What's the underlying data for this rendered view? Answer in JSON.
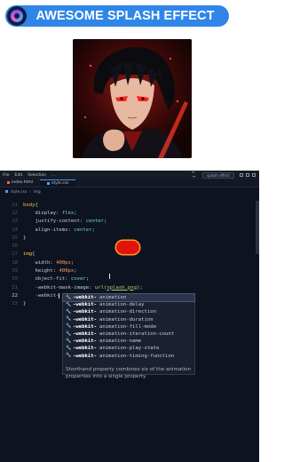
{
  "header": {
    "title": "AWESOME SPLASH EFFECT",
    "logo": "purple-ring-logo"
  },
  "hero": {
    "description_icon": "anime-character-artwork"
  },
  "editor": {
    "menu": [
      "File",
      "Edit",
      "Selection",
      "..."
    ],
    "nav_arrows": "← →",
    "search_placeholder": "splash effect",
    "tabs": [
      {
        "label": "index.html",
        "type": "html"
      },
      {
        "label": "style.css",
        "type": "css",
        "active": true
      }
    ],
    "breadcrumb": [
      "style.css",
      "img"
    ],
    "lines": [
      {
        "n": "11"
      },
      {
        "n": "12"
      },
      {
        "n": "13"
      },
      {
        "n": "14"
      },
      {
        "n": "15"
      },
      {
        "n": "16"
      },
      {
        "n": "17"
      },
      {
        "n": "18"
      },
      {
        "n": "19"
      },
      {
        "n": "20"
      },
      {
        "n": "21"
      },
      {
        "n": "22"
      },
      {
        "n": "23"
      }
    ],
    "code": {
      "body_sel": "body",
      "display": "display",
      "display_val": "flex",
      "justify": "justify-content",
      "justify_val": "center",
      "align": "align-items",
      "align_val": "center",
      "img_sel": "img",
      "width": "width",
      "width_val": "400px",
      "height": "height",
      "height_val": "400px",
      "fit": "object-fit",
      "fit_val": "cover",
      "mask": "-webkit-mask-image",
      "mask_fn": "url",
      "mask_arg": "splash.png",
      "typing": "-webkit-"
    },
    "suggestions": [
      {
        "bold": "-webkit-",
        "rest": "animation"
      },
      {
        "bold": "-webkit-",
        "rest": "animation-delay"
      },
      {
        "bold": "-webkit-",
        "rest": "animation-direction"
      },
      {
        "bold": "-webkit-",
        "rest": "animation-duration"
      },
      {
        "bold": "-webkit-",
        "rest": "animation-fill-mode"
      },
      {
        "bold": "-webkit-",
        "rest": "animation-iteration-count"
      },
      {
        "bold": "-webkit-",
        "rest": "animation-name"
      },
      {
        "bold": "-webkit-",
        "rest": "animation-play-state"
      },
      {
        "bold": "-webkit-",
        "rest": "animation-timing-function"
      }
    ],
    "suggestion_desc": "Shorthand property combines six of the animation properties into a single property."
  },
  "colors": {
    "banner": "#2f86e8",
    "editor_bg": "#0e1320",
    "blob": "#e3120f"
  }
}
